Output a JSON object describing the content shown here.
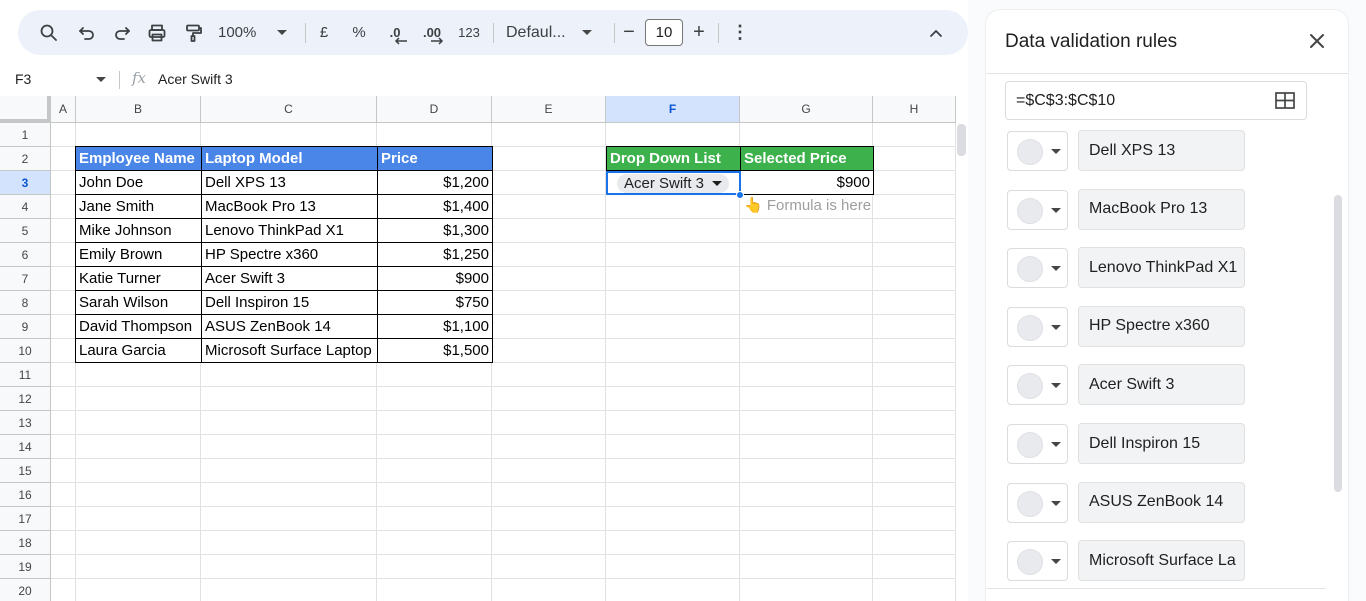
{
  "toolbar": {
    "search_icon": "search-icon",
    "undo_icon": "undo-icon",
    "redo_icon": "redo-icon",
    "print_icon": "print-icon",
    "paint_format_icon": "paint-format-icon",
    "zoom": "100%",
    "currency": "£",
    "percent": "%",
    "decrease_decimal": ".0",
    "increase_decimal": ".00",
    "number_format": "123",
    "font": "Defaul...",
    "font_size": "10",
    "minus": "−",
    "plus": "+",
    "more": "⋮",
    "collapse": "^"
  },
  "formula_bar": {
    "name_box": "F3",
    "fx": "fx",
    "content": "Acer Swift 3"
  },
  "columns": [
    "A",
    "B",
    "C",
    "D",
    "E",
    "F",
    "G",
    "H"
  ],
  "rows": [
    "1",
    "2",
    "3",
    "4",
    "5",
    "6",
    "7",
    "8",
    "9",
    "10",
    "11",
    "12",
    "13",
    "14",
    "15",
    "16",
    "17",
    "18",
    "19",
    "20"
  ],
  "table": {
    "headers": [
      "Employee Name",
      "Laptop Model",
      "Price"
    ],
    "rows": [
      [
        "John Doe",
        "Dell XPS 13",
        "$1,200"
      ],
      [
        "Jane Smith",
        "MacBook Pro 13",
        "$1,400"
      ],
      [
        "Mike Johnson",
        "Lenovo ThinkPad X1",
        "$1,300"
      ],
      [
        "Emily Brown",
        "HP Spectre x360",
        "$1,250"
      ],
      [
        "Katie Turner",
        "Acer Swift 3",
        "$900"
      ],
      [
        "Sarah Wilson",
        "Dell Inspiron 15",
        "$750"
      ],
      [
        "David Thompson",
        "ASUS ZenBook 14",
        "$1,100"
      ],
      [
        "Laura Garcia",
        "Microsoft Surface Laptop",
        "$1,500"
      ]
    ]
  },
  "lookup": {
    "header_dropdown": "Drop Down List",
    "header_price": "Selected Price",
    "dropdown_value": "Acer Swift 3",
    "price_value": "$900",
    "note": "👆 Formula is here"
  },
  "panel": {
    "title": "Data validation rules",
    "range": "=$C$3:$C$10",
    "options": [
      "Dell XPS 13",
      "MacBook Pro 13",
      "Lenovo ThinkPad X1",
      "HP Spectre x360",
      "Acer Swift 3",
      "Dell Inspiron 15",
      "ASUS ZenBook 14",
      "Microsoft Surface La"
    ]
  },
  "colors": {
    "header_blue": "#4a86e8",
    "header_green": "#3db14b",
    "selection": "#1a73e8",
    "toolbar_bg": "#edf2fa"
  }
}
